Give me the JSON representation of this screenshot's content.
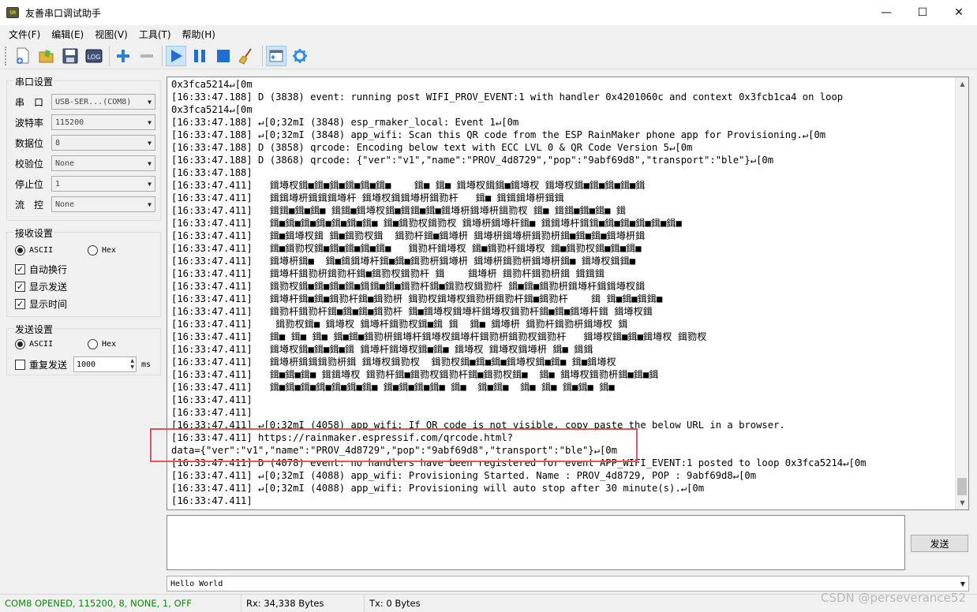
{
  "window": {
    "icon_text": "SM",
    "title": "友善串口调试助手",
    "minimize": "—",
    "maximize": "☐",
    "close": "✕"
  },
  "menu": [
    "文件(F)",
    "编辑(E)",
    "视图(V)",
    "工具(T)",
    "帮助(H)"
  ],
  "toolbar": {
    "log_label": "LOG"
  },
  "serial_settings": {
    "title": "串口设置",
    "port_label": "串　口",
    "port_value": "USB-SER...(COM8)",
    "baud_label": "波特率",
    "baud_value": "115200",
    "databits_label": "数据位",
    "databits_value": "8",
    "parity_label": "校验位",
    "parity_value": "None",
    "stopbits_label": "停止位",
    "stopbits_value": "1",
    "flow_label": "流　控",
    "flow_value": "None"
  },
  "receive_settings": {
    "title": "接收设置",
    "ascii_label": "ASCII",
    "hex_label": "Hex",
    "auto_wrap_label": "自动换行",
    "show_send_label": "显示发送",
    "show_time_label": "显示时间",
    "check_mark": "✓"
  },
  "send_settings": {
    "title": "发送设置",
    "ascii_label": "ASCII",
    "hex_label": "Hex",
    "repeat_label": "重复发送",
    "interval_value": "1000",
    "interval_unit": "ms"
  },
  "receive": {
    "lines": [
      "0x3fca5214↵[0m",
      "[16:33:47.188] D (3838) event: running post WIFI_PROV_EVENT:1 with handler 0x4201060c and context 0x3fcb1ca4 on loop",
      "0x3fca5214↵[0m",
      "[16:33:47.188] ↵[0;32mI (3848) esp_rmaker_local: Event 1↵[0m",
      "[16:33:47.188] ↵[0;32mI (3848) app_wifi: Scan this QR code from the ESP RainMaker phone app for Provisioning.↵[0m",
      "[16:33:47.188] D (3858) qrcode: Encoding below text with ECC LVL 0 & QR Code Version 5↵[0m",
      "[16:33:47.188] D (3868) qrcode: {\"ver\":\"v1\",\"name\":\"PROV_4d8729\",\"pop\":\"9abf69d8\",\"transport\":\"ble\"}↵[0m",
      "[16:33:47.188]",
      "[16:33:47.411]   鍓墫杈鍓■鍓■鍓■鍓■鍓■鍓■    鍓■ 鍓■ 鍓墫杈鍓鍓■鍓墫杈 鍓墫杈鍓■鍓■鍓■鍓■鍓",
      "[16:33:47.411]   鍓鍓墫枅鍓鍓鍓墫杆 鍓墫杈鍓鍓墫枅鍓勠杆   鍓■ 鍓鍓鍓墫枅鍓鍓",
      "[16:33:47.411]   鍓鍓■鍓■鍓■ 鍓鍓■鍓墫杈鍓■鍓鍓■鍓■鍓墫枅鍓墫枅鍓勠杈 鍓■ 鍓鍓■鍓■鍓■ 鍓",
      "[16:33:47.411]   鍓■鍓■鍓■鍓■鍓■鍓■鍓■ 鍓■鍓勠杈鍓勠杈 鍓墫枅鍓墫杆鍓■ 鍓鍓墫杆鍓鍓■鍓■鍓■鍓■鍓■鍓■",
      "[16:33:47.411]   鍓■鍓墫杈鍓 鍓■鍓勠杈鍓  鍓勠杆鍓■鍓墫枅 鍓墫枅鍓墫枅鍓勠枅鍓■鍓■鍓■鍓墫枅鍓",
      "[16:33:47.411]   鍓■鍓勠杈鍓■鍓■鍓■鍓■鍓■   鍓勠杆鍓墫杈 鍓■鍓勠杆鍓墫杈 鍓■鍓勠杈鍓■鍓■鍓■",
      "[16:33:47.411]   鍓墫枅鍓■  鍓■鍓鍓墫杆鍓■鍓■鍓勠枅鍓墫枅 鍓墫枅鍓勠枅鍓墫枅鍓■ 鍓墫杈鍓鍓■",
      "[16:33:47.411]   鍓墫杆鍓勠枅鍓勠杆鍓■鍓勠杈鍓勠杆 鍓    鍓墫枅 鍓勠杆鍓勠枅鍓 鍓鍓鍓",
      "[16:33:47.411]   鍓勠杈鍓■鍓■鍓■鍓■鍓鍓■鍓■鍓勠杆鍓■鍓勠杈鍓勠杆 鍓■鍓■鍓勠枅鍓墫杆鍓鍓墫杈鍓",
      "[16:33:47.411]   鍓墫杆鍓■鍓■鍓勠杆鍓■鍓勠枅 鍓勠杈鍓墫杈鍓勠枅鍓勠杆鍓■鍓勠杆    鍓 鍓■鍓■鍓鍓■",
      "[16:33:47.411]   鍓勠杆鍓勠杆鍓■鍓■鍓■鍓勠杆 鍓■鍓墫杈鍓墫杆鍓墫杈鍓勠杆鍓■鍓■鍓墫杆鍓 鍓墫杈鍓",
      "[16:33:47.411]    鍓勠杈鍓■ 鍓墫杈 鍓墫杆鍓勠杈鍓■鍓 鍓  鍓■ 鍓墫枅 鍓勠杆鍓勠枅鍓墫杈 鍓",
      "[16:33:47.411]   鍓■ 鍓■ 鍓■ 鍓■鍓■鍓勠枅鍓墫杆鍓墫杈鍓墫杆鍓勠枅鍓勠杈鍓勠杆   鍓墫杈鍓■鍓■鍓墫杈 鍓勠杈",
      "[16:33:47.411]   鍓墫杈鍓■鍓■鍓■鍓 鍓墫杆鍓墫杈鍓■鍓■ 鍓墫杈 鍓墫杈鍓墫枅 鍓■ 鍓鍓",
      "[16:33:47.411]   鍓墫枅鍓鍓鍓勠枅鍓 鍓墫杈鍓勠杈  鍓勠杈鍓■鍓■鍓■鍓墫杈鍓■鍓■ 鍓■鍓墫杈",
      "[16:33:47.411]   鍓■鍓■鍓■ 鍓鍓墫杈 鍓勠杆鍓■鍓勠杈鍓勠杆鍓■鍓勠杈鍓■  鍓■ 鍓墫杈鍓勠枅鍓■鍓■鍓",
      "[16:33:47.411]   鍓■鍓■鍓■鍓■鍓■鍓■鍓■ 鍓■鍓■鍓■鍓■ 鍓■  鍓■鍓■  鍓■ 鍓■ 鍓■鍓■ 鍓■",
      "[16:33:47.411]",
      "[16:33:47.411]",
      "[16:33:47.411] ↵[0;32mI (4058) app_wifi: If QR code is not visible, copy paste the below URL in a browser.",
      "[16:33:47.411] https://rainmaker.espressif.com/qrcode.html?",
      "data={\"ver\":\"v1\",\"name\":\"PROV_4d8729\",\"pop\":\"9abf69d8\",\"transport\":\"ble\"}↵[0m",
      "[16:33:47.411] D (4078) event: no handlers have been registered for event APP_WIFI_EVENT:1 posted to loop 0x3fca5214↵[0m",
      "[16:33:47.411] ↵[0;32mI (4088) app_wifi: Provisioning Started. Name : PROV_4d8729, POP : 9abf69d8↵[0m",
      "[16:33:47.411] ↵[0;32mI (4088) app_wifi: Provisioning will auto stop after 30 minute(s).↵[0m",
      "[16:33:47.411]"
    ]
  },
  "send": {
    "text": "",
    "send_button": "发送",
    "history_value": "Hello World"
  },
  "status": {
    "port_state": "COM8 OPENED, 115200, 8, NONE, 1, OFF",
    "rx": "Rx: 34,338 Bytes",
    "tx": "Tx: 0 Bytes"
  },
  "watermark": "CSDN @perseverance52",
  "colors": {
    "status_open": "#0a8a0a",
    "highlight": "#e05555"
  }
}
